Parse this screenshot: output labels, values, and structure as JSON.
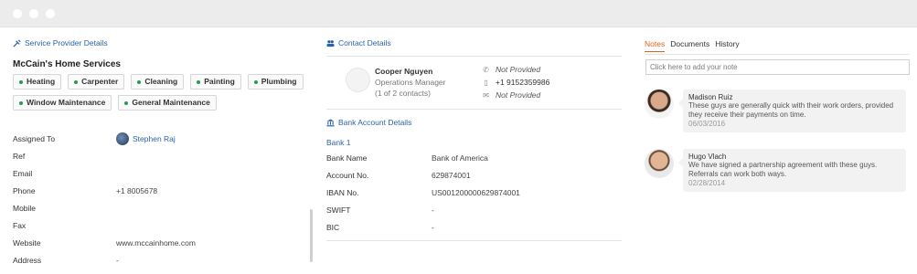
{
  "provider": {
    "section_title": "Service Provider Details",
    "company": "McCain's Home Services",
    "tags": [
      "Heating",
      "Carpenter",
      "Cleaning",
      "Painting",
      "Plumbing",
      "Window Maintenance",
      "General Maintenance"
    ],
    "assigned_label": "Assigned To",
    "assigned_to": "Stephen Raj",
    "fields": [
      {
        "label": "Ref",
        "value": ""
      },
      {
        "label": "Email",
        "value": ""
      },
      {
        "label": "Phone",
        "value": "+1 8005678"
      },
      {
        "label": "Mobile",
        "value": ""
      },
      {
        "label": "Fax",
        "value": ""
      },
      {
        "label": "Website",
        "value": "www.mccainhome.com"
      },
      {
        "label": "Address",
        "value": "-"
      }
    ]
  },
  "contact": {
    "section_title": "Contact Details",
    "name": "Cooper Nguyen",
    "role": "Operations Manager",
    "count": "(1 of 2 contacts)",
    "phone": "Not Provided",
    "mobile": "+1 9152359986",
    "email": "Not Provided"
  },
  "bank": {
    "section_title": "Bank Account Details",
    "account_title": "Bank 1",
    "rows": [
      {
        "label": "Bank Name",
        "value": "Bank of America"
      },
      {
        "label": "Account No.",
        "value": "629874001"
      },
      {
        "label": "IBAN No.",
        "value": "US001200000629874001"
      },
      {
        "label": "SWIFT",
        "value": "-"
      },
      {
        "label": "BIC",
        "value": "-"
      }
    ]
  },
  "notes": {
    "tabs": [
      "Notes",
      "Documents",
      "History"
    ],
    "active_tab": "Notes",
    "input_placeholder": "Click here to add your note",
    "items": [
      {
        "author": "Madison Ruiz",
        "text": "These guys are generally quick with their work orders, provided they receive their payments on time.",
        "date": "06/03/2016"
      },
      {
        "author": "Hugo Vlach",
        "text": "We have signed a partnership agreement with these guys. Referrals can work both ways.",
        "date": "02/28/2014"
      }
    ]
  },
  "colors": {
    "accent": "#2a62a8",
    "active_tab": "#d9641e",
    "tag_dot": "#2e9a48"
  }
}
